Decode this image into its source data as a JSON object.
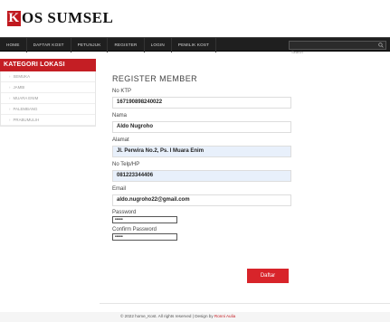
{
  "logo": {
    "initial": "K",
    "rest": "OS SUMSEL"
  },
  "nav": {
    "items": [
      "HOME",
      "DAFTAR KOST",
      "PETUNJUK",
      "REGISTER",
      "LOGIN",
      "PEMILIK KOST"
    ],
    "search_placeholder": "Search"
  },
  "sidebar": {
    "title": "KATEGORI LOKASI",
    "items": [
      "SEMUKA",
      "JAMBI",
      "MUARA ENIM",
      "PALEMBANG",
      "PRABUMULIH"
    ]
  },
  "form": {
    "title": "REGISTER MEMBER",
    "ktp_label": "No KTP",
    "ktp_value": "167190898240022",
    "nama_label": "Nama",
    "nama_value": "Aldo Nugroho",
    "alamat_label": "Alamat",
    "alamat_value": "Jl. Perwira No.2, Ps. I Muara Enim",
    "telp_label": "No Telp/HP",
    "telp_value": "081223344406",
    "email_label": "Email",
    "email_value": "aldo.nugroho22@gmail.com",
    "password_label": "Password",
    "password_value": "•••••",
    "confirm_label": "Confirm Password",
    "confirm_value": "•••••",
    "submit_label": "Daftar"
  },
  "footer": {
    "text": "© 2022 home_Kost. All rights reserved | Design by ",
    "link": "Ronni Aulia"
  },
  "colors": {
    "accent": "#c41e24",
    "navbar": "#1f1f1f",
    "filled_field": "#e8f0fb"
  }
}
